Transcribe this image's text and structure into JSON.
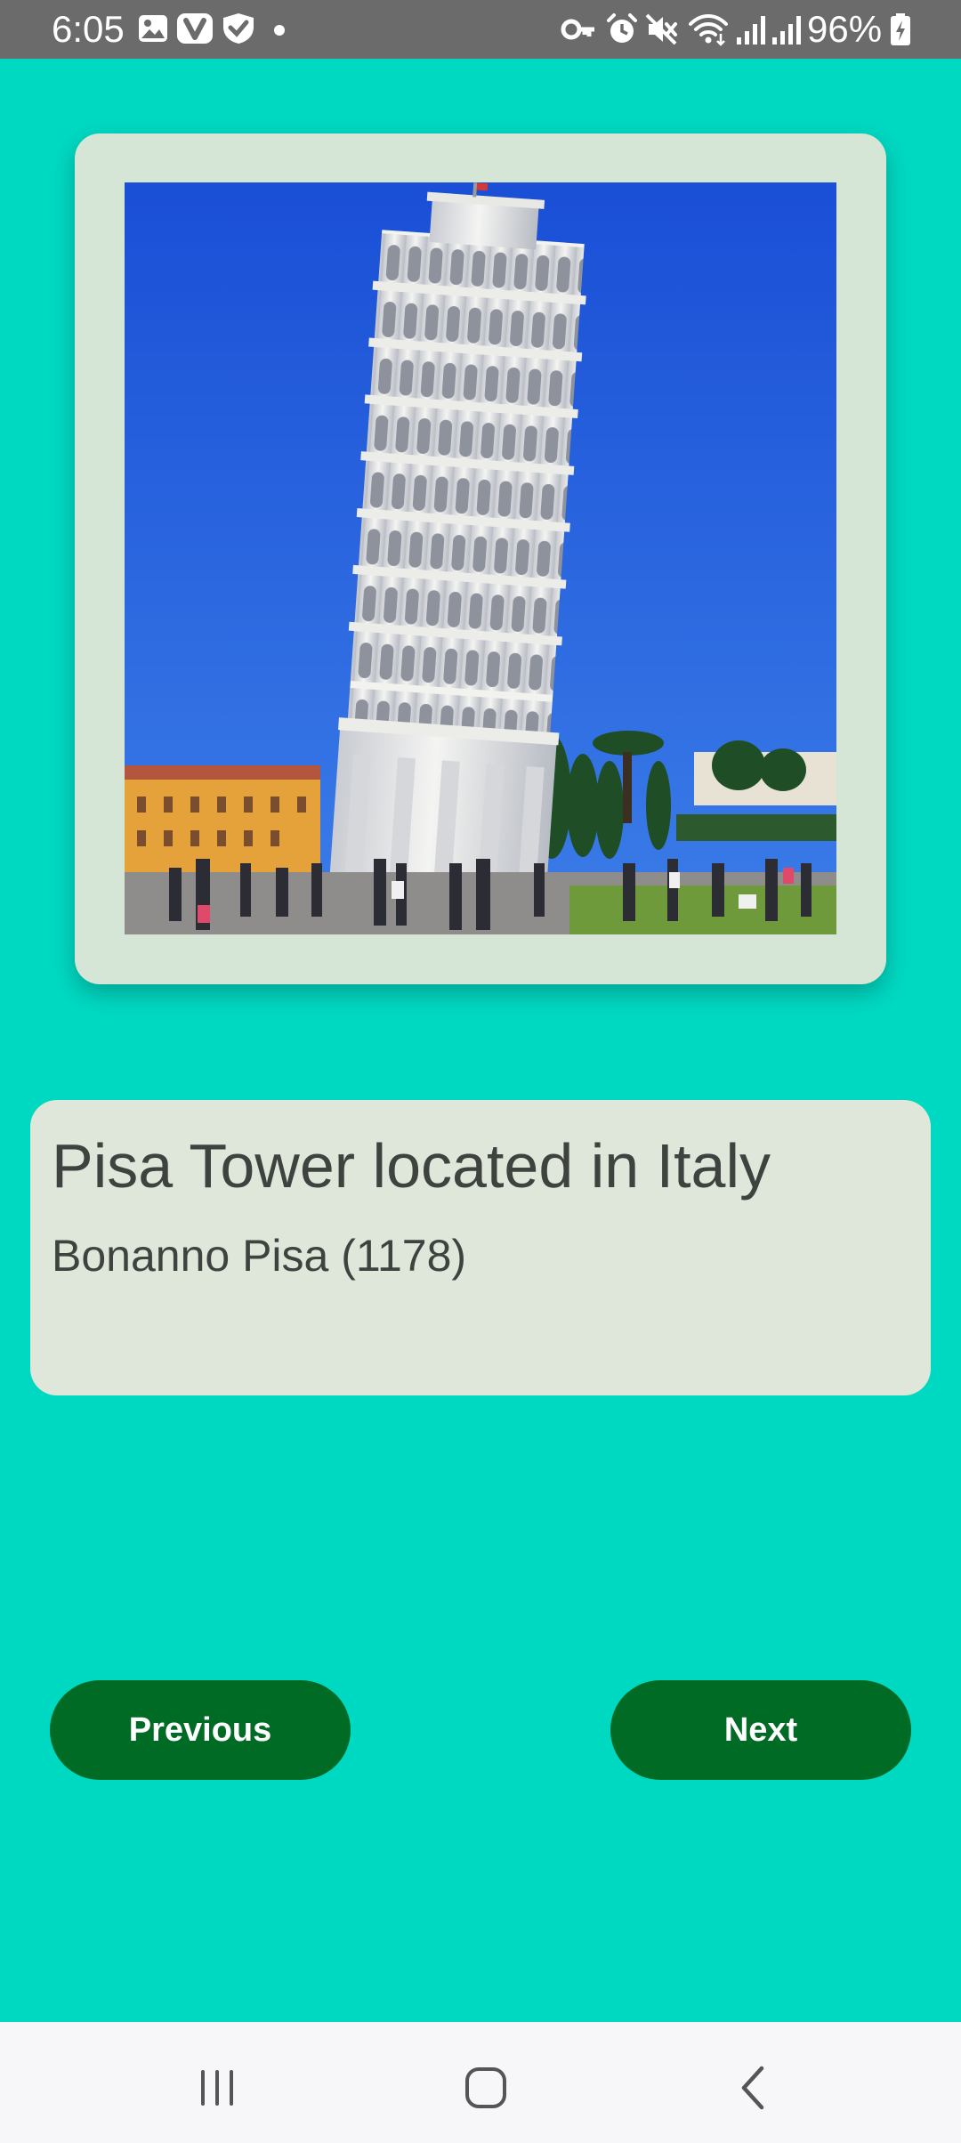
{
  "status_bar": {
    "time": "6:05",
    "battery_percent": "96%",
    "left_icons": [
      "gallery-icon",
      "vivaldi-icon",
      "vpn-shield-icon",
      "notification-dot"
    ],
    "right_icons": [
      "key-icon",
      "alarm-icon",
      "mute-icon",
      "wifi-icon",
      "signal-icon",
      "signal-icon",
      "battery-charging-icon"
    ]
  },
  "landmark": {
    "image_icon": "leaning-tower-photo",
    "title": "Pisa Tower located in Italy",
    "subtitle": "Bonanno Pisa (1178)"
  },
  "buttons": {
    "previous_label": "Previous",
    "next_label": "Next"
  },
  "nav_bar": {
    "icons": [
      "recent-apps-icon",
      "home-icon",
      "back-icon"
    ]
  },
  "colors": {
    "background": "#00d9c2",
    "button": "#006b25",
    "image_card": "#d5e6d6",
    "text_card": "#dfe6da"
  }
}
